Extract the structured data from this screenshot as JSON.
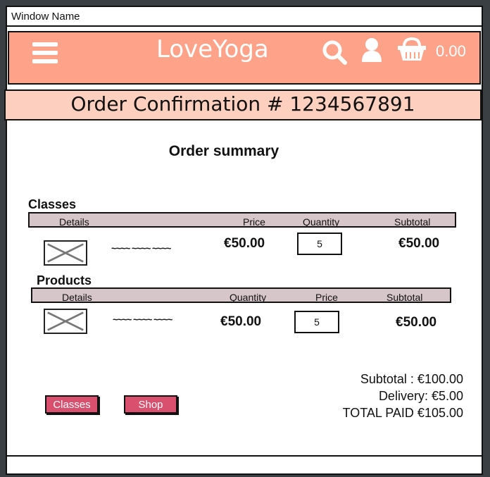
{
  "window": {
    "title": "Window Name"
  },
  "nav": {
    "logo": "LoveYoga",
    "cart_total": "0.00",
    "icons": [
      "menu-icon",
      "search-icon",
      "user-icon",
      "basket-icon"
    ]
  },
  "confirmation": {
    "title": "Order Confirmation # 1234567891"
  },
  "summary": {
    "title": "Order summary"
  },
  "classes": {
    "heading": "Classes",
    "columns": [
      "Details",
      "Price",
      "Quantity",
      "Subtotal"
    ],
    "row": {
      "description": "~~~~ ~~~~ ~~~~",
      "price": "€50.00",
      "quantity": "5",
      "subtotal": "€50.00"
    }
  },
  "products": {
    "heading": "Products",
    "columns": [
      "Details",
      "Quantity",
      "Price",
      "Subtotal"
    ],
    "row": {
      "description": "~~~~ ~~~~ ~~~~",
      "price": "€50.00",
      "quantity": "5",
      "subtotal": "€50.00"
    }
  },
  "totals": {
    "subtotal": "Subtotal : €100.00",
    "delivery": "Delivery: €5.00",
    "total": "TOTAL PAID €105.00"
  },
  "buttons": {
    "classes": "Classes",
    "shop": "Shop"
  },
  "colors": {
    "nav": "#ffa28a",
    "banner": "#fdcfbf",
    "table_header": "#d6c5c9",
    "button": "#d9506f"
  }
}
